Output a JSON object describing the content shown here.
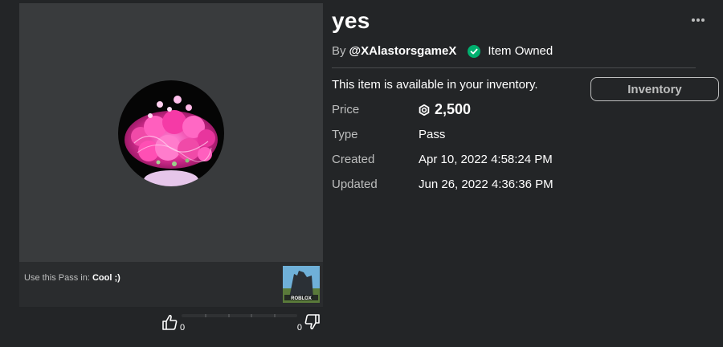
{
  "thumbnail": {
    "use_prefix": "Use this Pass in:",
    "game_name": "Cool ;)",
    "game_thumb_label": "ROBLOX"
  },
  "votes": {
    "up_count": "0",
    "down_count": "0"
  },
  "item": {
    "title": "yes",
    "by_prefix": "By",
    "creator": "@XAlastorsgameX",
    "owned_label": "Item Owned",
    "availability": "This item is available in your inventory.",
    "inventory_button": "Inventory"
  },
  "details": [
    {
      "label": "Price",
      "value": "2,500"
    },
    {
      "label": "Type",
      "value": "Pass"
    },
    {
      "label": "Created",
      "value": "Apr 10, 2022 4:58:24 PM"
    },
    {
      "label": "Updated",
      "value": "Jun 26, 2022 4:36:36 PM"
    }
  ],
  "icons": {
    "owned": "checkmark-circle-icon",
    "currency": "robux-icon",
    "more": "more-options-icon",
    "like": "thumbs-up-icon",
    "dislike": "thumbs-down-icon"
  },
  "colors": {
    "background": "#232527",
    "panel": "#393b3d",
    "owned_green": "#00b06f",
    "text_primary": "#ffffff",
    "text_secondary": "#bdbebe"
  }
}
